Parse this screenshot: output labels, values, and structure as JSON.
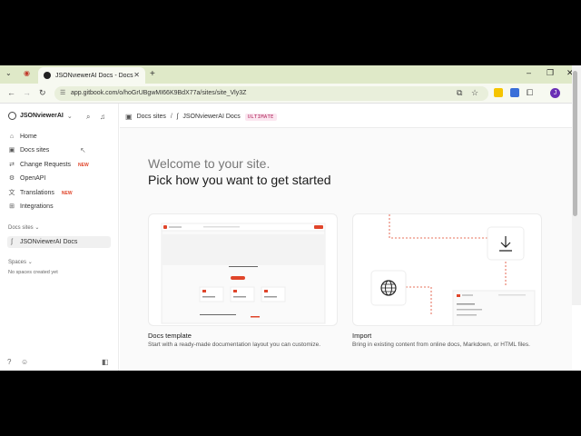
{
  "browser": {
    "tab_title": "JSONviewerAI Docs - Docs site",
    "url": "app.gitbook.com/o/hoGrUBgwMI66K9BdX77a/sites/site_Vly3Z",
    "profile_initial": "J"
  },
  "sidebar": {
    "org_name": "JSONviewerAI",
    "items": [
      {
        "label": "Home",
        "icon": "home-icon"
      },
      {
        "label": "Docs sites",
        "icon": "docs-sites-icon"
      },
      {
        "label": "Change Requests",
        "icon": "change-requests-icon",
        "badge": "NEW"
      },
      {
        "label": "OpenAPI",
        "icon": "openapi-icon"
      },
      {
        "label": "Translations",
        "icon": "translations-icon",
        "badge": "NEW"
      },
      {
        "label": "Integrations",
        "icon": "integrations-icon"
      }
    ],
    "docs_sites_label": "Docs sites",
    "docs_site_item": "JSONviewerAI Docs",
    "spaces_label": "Spaces",
    "spaces_empty": "No spaces created yet"
  },
  "breadcrumb": {
    "root": "Docs sites",
    "separator": "/",
    "current": "JSONviewerAI Docs",
    "plan_badge": "ULTIMATE"
  },
  "main": {
    "welcome": "Welcome to your site.",
    "pick": "Pick how you want to get started",
    "cards": [
      {
        "title": "Docs template",
        "desc": "Start with a ready-made documentation layout you can customize."
      },
      {
        "title": "Import",
        "desc": "Bring in existing content from online docs, Markdown, or HTML files."
      }
    ]
  },
  "colors": {
    "accent": "#e0452a",
    "tabbar": "#dfe9c8"
  }
}
